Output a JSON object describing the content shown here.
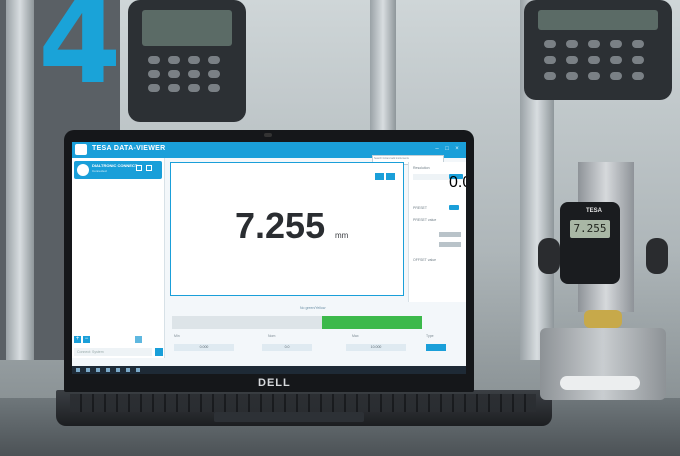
{
  "app": {
    "title": "TESA DATA-VIEWER",
    "tooltip": "Search for/and add instruments"
  },
  "sidebar": {
    "device_name": "DIALTRONIC CONNECT",
    "device_sub": "Connected",
    "search_placeholder": "Connect: System"
  },
  "readout": {
    "value": "7.255",
    "unit": "mm"
  },
  "settings": {
    "resolution_label": "Resolution",
    "preset_label": "PRESET",
    "preset_value_label": "PRESET value",
    "offset_label": "OFFSET value",
    "unit_value": "0.00"
  },
  "tolerance": {
    "title": "No green/Yellow",
    "min_label": "Min",
    "nominal_label": "Nom",
    "max_label": "Max",
    "type_label": "Type",
    "min_value": "0.000",
    "nominal_value": "0.0",
    "max_value": "10.000",
    "green_start": 0.6,
    "green_end": 1.0
  },
  "laptop_brand": "DELL",
  "gauge": {
    "brand": "TESA",
    "display_value": "7.255"
  },
  "background": {
    "big_digit": "4"
  },
  "colors": {
    "accent": "#1a9fd9",
    "green_zone": "#3cb94b"
  }
}
